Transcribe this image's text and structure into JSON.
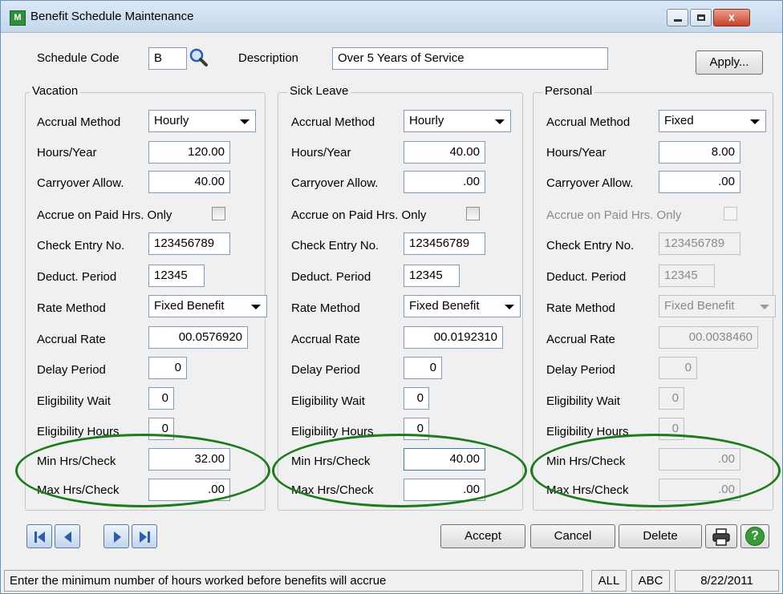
{
  "window": {
    "title": "Benefit Schedule Maintenance",
    "app_icon_text": "M",
    "close_glyph": "x"
  },
  "header": {
    "schedule_code_label": "Schedule Code",
    "schedule_code_value": "B",
    "description_label": "Description",
    "description_value": "Over 5 Years of Service",
    "apply_button": "Apply..."
  },
  "labels": {
    "accrual_method": "Accrual Method",
    "hours_year": "Hours/Year",
    "carryover": "Carryover Allow.",
    "accrue_paid": "Accrue on Paid Hrs. Only",
    "check_entry": "Check Entry No.",
    "deduct_period": "Deduct. Period",
    "rate_method": "Rate Method",
    "accrual_rate": "Accrual Rate",
    "delay_period": "Delay Period",
    "elig_wait": "Eligibility Wait",
    "elig_hours": "Eligibility Hours",
    "min_hrs": "Min Hrs/Check",
    "max_hrs": "Max Hrs/Check"
  },
  "vacation": {
    "title": "Vacation",
    "accrual_method": "Hourly",
    "hours_year": "120.00",
    "carryover": "40.00",
    "accrue_paid": false,
    "check_entry": "123456789",
    "deduct_period": "12345",
    "rate_method": "Fixed Benefit",
    "accrual_rate": "00.0576920",
    "delay_period": "0",
    "elig_wait": "0",
    "elig_hours": "0",
    "min_hrs": "32.00",
    "max_hrs": ".00"
  },
  "sick": {
    "title": "Sick Leave",
    "accrual_method": "Hourly",
    "hours_year": "40.00",
    "carryover": ".00",
    "accrue_paid": false,
    "check_entry": "123456789",
    "deduct_period": "12345",
    "rate_method": "Fixed Benefit",
    "accrual_rate": "00.0192310",
    "delay_period": "0",
    "elig_wait": "0",
    "elig_hours": "0",
    "min_hrs": "40.00",
    "max_hrs": ".00"
  },
  "personal": {
    "title": "Personal",
    "accrual_method": "Fixed",
    "hours_year": "8.00",
    "carryover": ".00",
    "accrue_paid": false,
    "check_entry": "123456789",
    "deduct_period": "12345",
    "rate_method": "Fixed Benefit",
    "accrual_rate": "00.0038460",
    "delay_period": "0",
    "elig_wait": "0",
    "elig_hours": "0",
    "min_hrs": ".00",
    "max_hrs": ".00"
  },
  "buttons": {
    "accept": "Accept",
    "cancel": "Cancel",
    "delete": "Delete",
    "help_glyph": "?"
  },
  "status": {
    "message": "Enter the minimum number of hours worked before benefits will accrue",
    "company_scope": "ALL",
    "company_code": "ABC",
    "date": "8/22/2011"
  },
  "colors": {
    "annotation_ellipse": "#1d7a1d",
    "help_icon": "#3a9a3a"
  }
}
